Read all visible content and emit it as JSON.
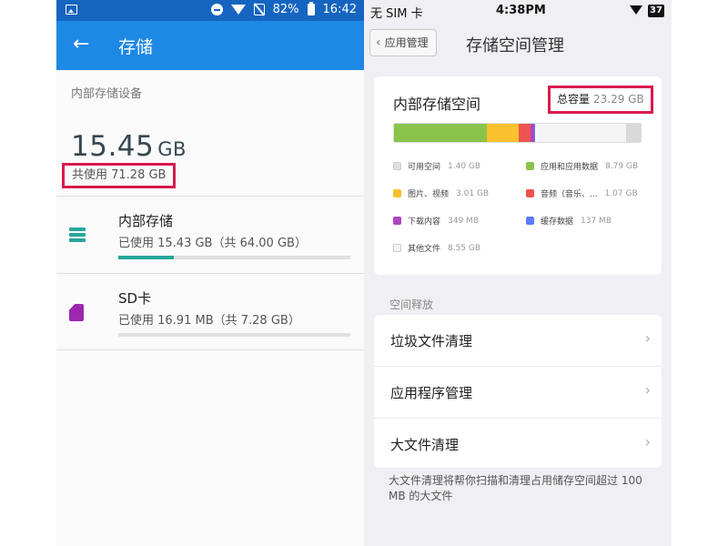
{
  "left": {
    "status": {
      "battery": "82%",
      "time": "16:42"
    },
    "appbar": {
      "title": "存储"
    },
    "section_label": "内部存储设备",
    "used_value": "15.45",
    "used_unit": "GB",
    "total_used": "共使用 71.28 GB",
    "items": [
      {
        "name": "内部存储",
        "detail": "已使用 15.43 GB（共 64.00 GB）",
        "usage_fraction": 0.24,
        "icon": "storage-icon",
        "color": "#26a69a"
      },
      {
        "name": "SD卡",
        "detail": "已使用 16.91 MB（共 7.28 GB）",
        "usage_fraction": 0.0,
        "icon": "sd-card-icon",
        "color": "#9c27b0"
      }
    ]
  },
  "right": {
    "status": {
      "carrier": "无 SIM 卡",
      "time": "4:38PM",
      "battery": "37"
    },
    "nav": {
      "back_label": "应用管理",
      "title": "存储空间管理"
    },
    "card": {
      "title": "内部存储空间",
      "total_label": "总容量",
      "total_value": "23.29 GB",
      "legend": [
        {
          "label": "可用空间",
          "value": "1.40 GB",
          "color": "#e0e0e0"
        },
        {
          "label": "应用和应用数据",
          "value": "8.79 GB",
          "color": "#8bc34a"
        },
        {
          "label": "图片、视频",
          "value": "3.01 GB",
          "color": "#fbc02d"
        },
        {
          "label": "音频（音乐、...",
          "value": "1.07 GB",
          "color": "#ef5350"
        },
        {
          "label": "下载内容",
          "value": "349 MB",
          "color": "#ab47bc"
        },
        {
          "label": "缓存数据",
          "value": "137 MB",
          "color": "#5c7cfa"
        },
        {
          "label": "其他文件",
          "value": "8.55 GB",
          "color": "#f5f5f5"
        }
      ]
    },
    "section_label": "空间释放",
    "menu": [
      "垃圾文件清理",
      "应用程序管理",
      "大文件清理"
    ],
    "footer_note": "大文件清理将帮你扫描和清理占用储存空间超过 100 MB 的大文件"
  }
}
